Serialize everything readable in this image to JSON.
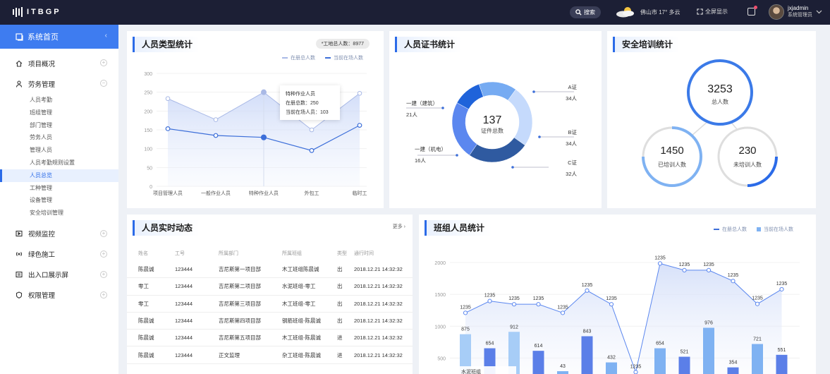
{
  "brand": {
    "logo_text": "ITBGP"
  },
  "topbar": {
    "search_label": "搜索",
    "weather_text": "佛山市 17° 多云",
    "fullscreen_label": "全屏显示",
    "user_name": "jxjadmin",
    "user_role": "系统管理员"
  },
  "sidebar": {
    "title": "系统首页",
    "collapse_icon": "‹",
    "items": [
      {
        "label": "项目概况"
      },
      {
        "label": "劳务管理"
      },
      {
        "label": "视频监控"
      },
      {
        "label": "绿色施工"
      },
      {
        "label": "出入口展示屏"
      },
      {
        "label": "权限管理"
      }
    ],
    "subitems": [
      "人员考勤",
      "班组管理",
      "部门管理",
      "劳务人员",
      "管理人员",
      "人员考勤规则设置",
      "人员总览",
      "工种管理",
      "设备管理",
      "安全培训管理"
    ],
    "active_sub": "人员总览"
  },
  "panel_person_type": {
    "title": "人员类型统计",
    "badge": "*工地总人数：8977",
    "legend": [
      "在册总人数",
      "当前在场人数"
    ],
    "tooltip": {
      "title": "特种作业人员",
      "line1": "在册总数：250",
      "line2": "当前在场人员：103"
    }
  },
  "panel_cert": {
    "title": "人员证书统计",
    "center_value": "137",
    "center_label": "证件总数",
    "labels": [
      {
        "name": "A证",
        "count": "34人"
      },
      {
        "name": "B证",
        "count": "34人"
      },
      {
        "name": "C证",
        "count": "32人"
      },
      {
        "name": "一建（机电）",
        "count": "16人"
      },
      {
        "name": "一建（建筑）",
        "count": "21人"
      }
    ]
  },
  "panel_training": {
    "title": "安全培训统计",
    "total_value": "3253",
    "total_label": "总人数",
    "trained_value": "1450",
    "trained_label": "已培训人数",
    "untrained_value": "230",
    "untrained_label": "未培训人数"
  },
  "panel_realtime": {
    "title": "人员实时动态",
    "more": "更多",
    "headers": [
      "姓名",
      "工号",
      "所属部门",
      "所属班组",
      "类型",
      "通行时间"
    ],
    "rows": [
      [
        "陈晨诚",
        "123444",
        "吉尼斯第一项目部",
        "木工班组陈晨诚",
        "出",
        "2018.12.21 14:32:32"
      ],
      [
        "零工",
        "123444",
        "吉尼斯第二项目部",
        "水泥班组-零工",
        "出",
        "2018.12.21 14:32:32"
      ],
      [
        "零工",
        "123444",
        "吉尼斯第三项目部",
        "木工班组-零工",
        "出",
        "2018.12.21 14:32:32"
      ],
      [
        "陈晨诚",
        "123444",
        "吉尼斯第四项目部",
        "钢筋班组-陈晨诚",
        "出",
        "2018.12.21 14:32:32"
      ],
      [
        "陈晨诚",
        "123444",
        "吉尼斯第五项目部",
        "木工班组-陈晨诚",
        "进",
        "2018.12.21 14:32:32"
      ],
      [
        "陈晨诚",
        "123444",
        "正文监理",
        "杂工班组-陈晨诚",
        "进",
        "2018.12.21 14:32:32"
      ]
    ]
  },
  "panel_team": {
    "title": "班组人员统计",
    "legend": [
      "在册总人数",
      "当前在场人数"
    ],
    "tooltip_title": "水泥班组"
  },
  "chart_data": [
    {
      "type": "line",
      "title": "人员类型统计",
      "categories": [
        "项目管理人员",
        "一般作业人员",
        "特种作业人员",
        "外包工",
        "临时工"
      ],
      "series": [
        {
          "name": "在册总人数",
          "values": [
            233,
            177,
            250,
            150,
            247
          ]
        },
        {
          "name": "当前在场人数",
          "values": [
            153,
            135,
            130,
            95,
            162
          ]
        }
      ],
      "ylim": [
        0,
        300
      ],
      "yticks": [
        0,
        50,
        100,
        150,
        200,
        250,
        300
      ],
      "color": [
        "#a9b9e6",
        "#3d6fd9"
      ],
      "legend": "top-right"
    },
    {
      "type": "pie",
      "title": "人员证书统计",
      "categories": [
        "A证",
        "B证",
        "C证",
        "一建（机电）",
        "一建（建筑）"
      ],
      "values": [
        34,
        34,
        32,
        16,
        21
      ],
      "colors": [
        "#c5dafc",
        "#2f5aa0",
        "#5b87ef",
        "#1f63da",
        "#76abf2"
      ]
    },
    {
      "type": "bar",
      "title": "班组人员统计",
      "yticks": [
        500,
        1000,
        1500,
        2000
      ],
      "ylim": [
        250,
        2200
      ],
      "line_values": [
        1235,
        1235,
        1235,
        1235,
        1235,
        1235,
        1235,
        1235,
        1235,
        1235,
        1235,
        1235,
        1235,
        1235
      ],
      "line_y_levels": [
        1210,
        1395,
        1345,
        1345,
        1210,
        1560,
        1345,
        280,
        1985,
        1880,
        1880,
        1710,
        1350,
        1580
      ],
      "bar_primary": [
        null,
        654,
        null,
        614,
        null,
        843,
        432,
        null,
        654,
        521,
        976,
        354,
        721,
        551
      ],
      "bar_secondary": [
        875,
        null,
        912,
        null,
        43,
        null,
        null,
        null,
        null,
        null,
        null,
        null,
        null,
        null
      ],
      "legend": "top-right"
    }
  ]
}
